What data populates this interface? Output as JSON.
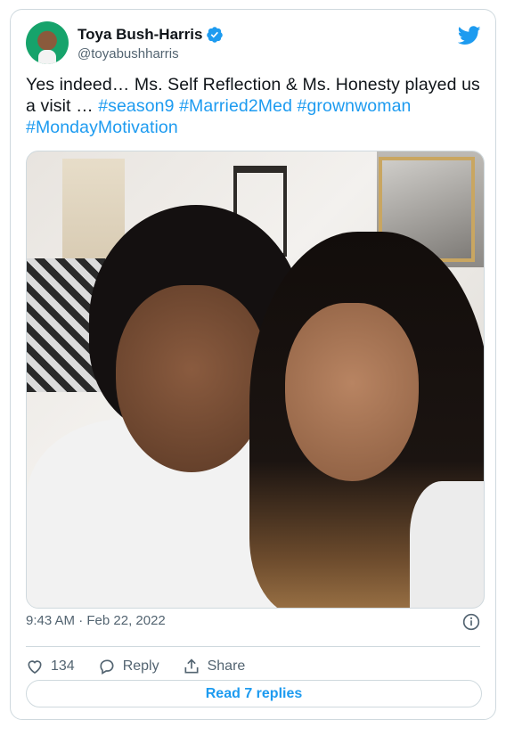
{
  "tweet": {
    "author_name": "Toya Bush-Harris",
    "author_handle": "@toyabushharris",
    "text_plain_1": "Yes indeed… Ms. Self Reflection & Ms. Honesty played us a visit … ",
    "hashtags": [
      "#season9",
      "#Married2Med",
      "#grownwoman",
      "#MondayMotivation"
    ],
    "timestamp": "9:43 AM · Feb 22, 2022",
    "likes": "134",
    "reply_label": "Reply",
    "share_label": "Share",
    "read_replies_label": "Read 7 replies"
  },
  "icons": {
    "verified": "verified-badge-icon",
    "brand": "twitter-bird-icon",
    "info": "info-icon",
    "like": "heart-icon",
    "reply": "speech-bubble-icon",
    "share": "share-upload-icon"
  },
  "colors": {
    "accent": "#1d9bf0",
    "text": "#0f1419",
    "secondary": "#536471",
    "border": "#cfd9de"
  }
}
